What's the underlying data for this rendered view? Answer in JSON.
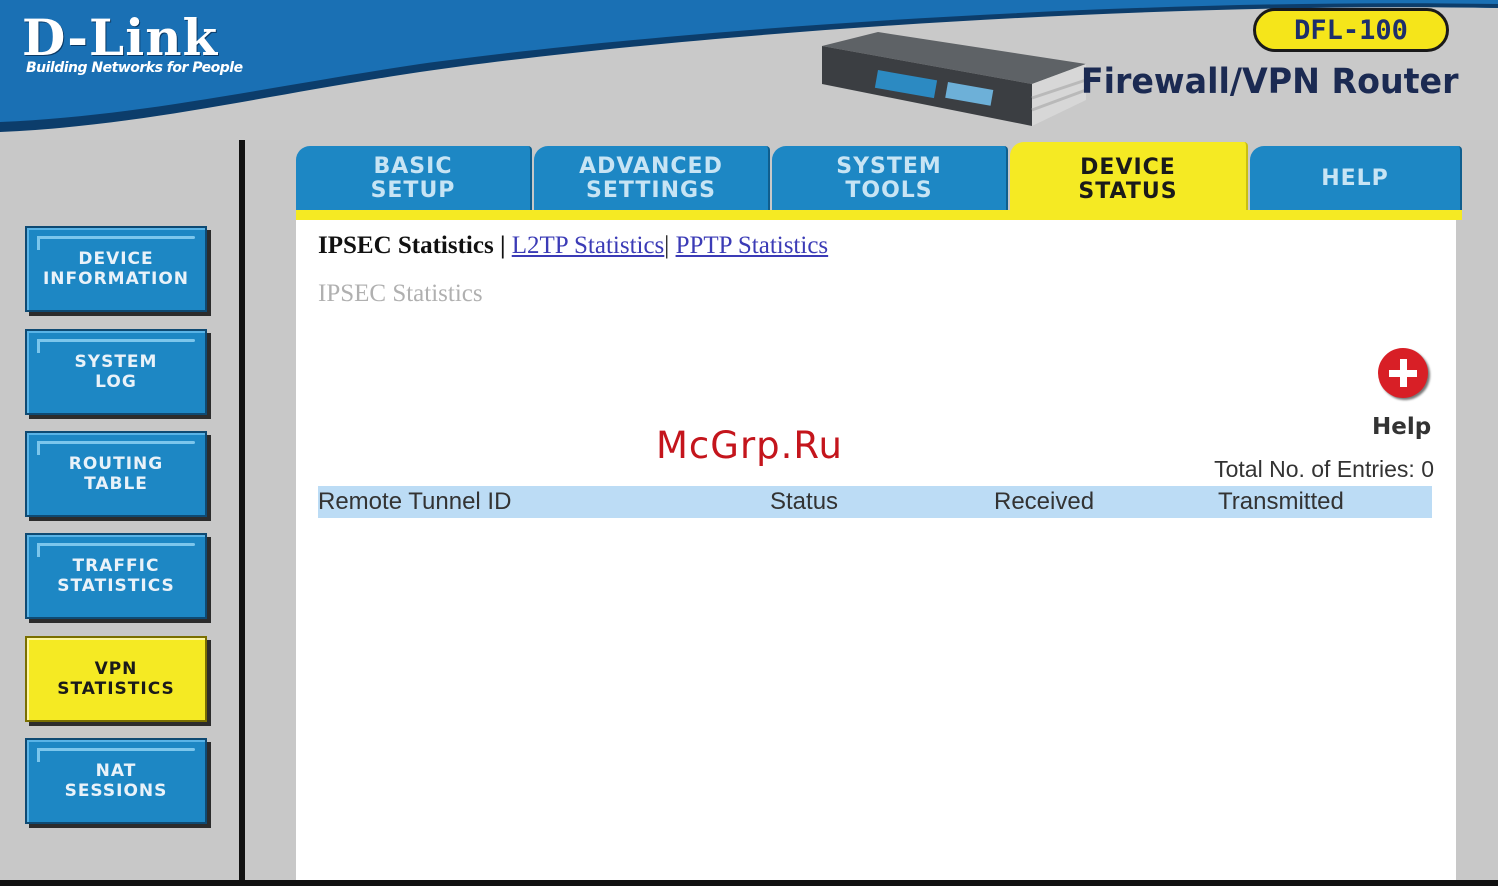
{
  "brand": {
    "logo": "D-Link",
    "tagline": "Building Networks for People",
    "model": "DFL-100",
    "product": "Firewall/VPN Router"
  },
  "tabs": [
    {
      "label": "BASIC\nSETUP",
      "active": false
    },
    {
      "label": "ADVANCED\nSETTINGS",
      "active": false
    },
    {
      "label": "SYSTEM\nTOOLS",
      "active": false
    },
    {
      "label": "DEVICE\nSTATUS",
      "active": true
    },
    {
      "label": "HELP",
      "active": false
    }
  ],
  "sidebar": {
    "items": [
      {
        "label": "DEVICE\nINFORMATION",
        "active": false
      },
      {
        "label": "SYSTEM\nLOG",
        "active": false
      },
      {
        "label": "ROUTING\nTABLE",
        "active": false
      },
      {
        "label": "TRAFFIC\nSTATISTICS",
        "active": false
      },
      {
        "label": "VPN\nSTATISTICS",
        "active": true
      },
      {
        "label": "NAT\nSESSIONS",
        "active": false
      }
    ]
  },
  "subnav": {
    "current": "IPSEC Statistics",
    "separator": "|",
    "links": [
      "L2TP Statistics",
      "PPTP Statistics"
    ]
  },
  "main": {
    "section_title": "IPSEC Statistics",
    "help_label": "Help",
    "entries_label": "Total No. of Entries: 0",
    "columns": [
      "Remote Tunnel ID",
      "Status",
      "Received",
      "Transmitted"
    ]
  },
  "watermark": "McGrp.Ru",
  "colors": {
    "brand_blue": "#1d87c4",
    "active_yellow": "#f5ea23",
    "table_header": "#bcdcf5",
    "help_red": "#d81f26"
  }
}
